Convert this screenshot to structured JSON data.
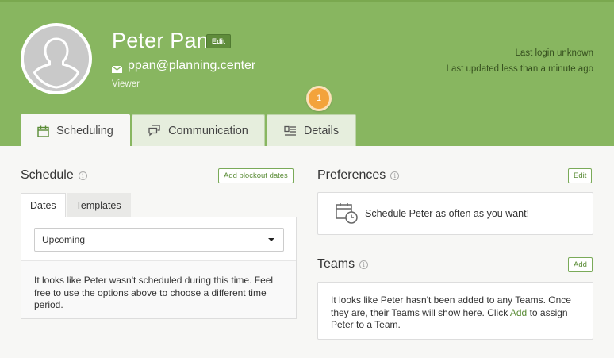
{
  "profile": {
    "name": "Peter Pan",
    "edit_label": "Edit",
    "email": "ppan@planning.center",
    "role": "Viewer",
    "last_login": "Last login unknown",
    "last_updated": "Last updated less than a minute ago"
  },
  "onboarding_badge": "1",
  "tabs": [
    {
      "label": "Scheduling",
      "icon": "calendar-icon",
      "active": true
    },
    {
      "label": "Communication",
      "icon": "chat-bubbles-icon",
      "active": false
    },
    {
      "label": "Details",
      "icon": "details-icon",
      "active": false
    }
  ],
  "schedule": {
    "title": "Schedule",
    "add_blockout_label": "Add blockout dates",
    "subtabs": [
      "Dates",
      "Templates"
    ],
    "select_value": "Upcoming",
    "empty_message": "It looks like Peter wasn't scheduled during this time. Feel free to use the options above to choose a different time period."
  },
  "preferences": {
    "title": "Preferences",
    "edit_label": "Edit",
    "message": "Schedule Peter as often as you want!"
  },
  "teams": {
    "title": "Teams",
    "add_label": "Add",
    "message_before": "It looks like Peter hasn't been added to any Teams. Once they are, their Teams will show here. Click ",
    "message_link": "Add",
    "message_after": " to assign Peter to a Team."
  },
  "colors": {
    "header_green": "#88b660",
    "accent_green": "#5a8c36",
    "badge_orange": "#f3a33b"
  }
}
